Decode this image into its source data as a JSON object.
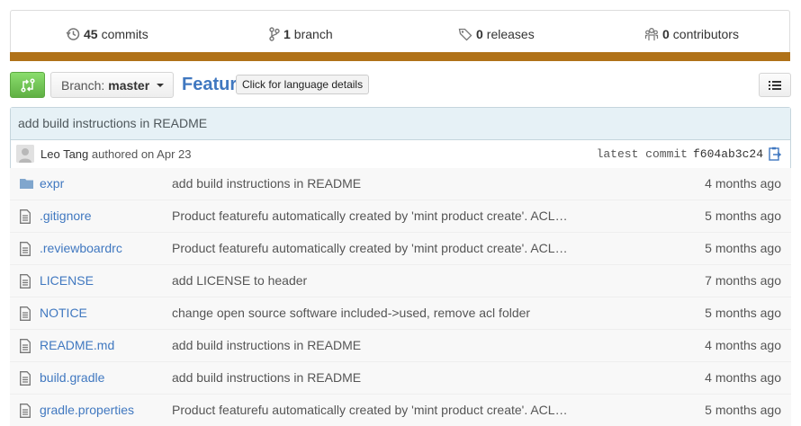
{
  "stats": {
    "commits": {
      "count": "45",
      "label": "commits"
    },
    "branches": {
      "count": "1",
      "label": "branch"
    },
    "releases": {
      "count": "0",
      "label": "releases"
    },
    "contributors": {
      "count": "0",
      "label": "contributors"
    },
    "language_color": "#b07219"
  },
  "toolbar": {
    "branch_prefix": "Branch:",
    "branch_name": "master",
    "repo_title": "Featur",
    "tooltip": "Click for language details"
  },
  "latest_commit": {
    "message": "add build instructions in README",
    "author": "Leo Tang",
    "authored_text": "authored on Apr 23",
    "label": "latest commit",
    "sha": "f604ab3c24"
  },
  "files": [
    {
      "icon": "folder-icon",
      "name": "expr",
      "message": "add build instructions in README",
      "age": "4 months ago"
    },
    {
      "icon": "file-icon",
      "name": ".gitignore",
      "message": "Product featurefu automatically created by 'mint product create'. ACL…",
      "age": "5 months ago"
    },
    {
      "icon": "file-icon",
      "name": ".reviewboardrc",
      "message": "Product featurefu automatically created by 'mint product create'. ACL…",
      "age": "5 months ago"
    },
    {
      "icon": "file-icon",
      "name": "LICENSE",
      "message": "add LICENSE to header",
      "age": "7 months ago"
    },
    {
      "icon": "file-icon",
      "name": "NOTICE",
      "message": "change open source software included->used, remove acl folder",
      "age": "5 months ago"
    },
    {
      "icon": "file-icon",
      "name": "README.md",
      "message": "add build instructions in README",
      "age": "4 months ago"
    },
    {
      "icon": "file-icon",
      "name": "build.gradle",
      "message": "add build instructions in README",
      "age": "4 months ago"
    },
    {
      "icon": "file-icon",
      "name": "gradle.properties",
      "message": "Product featurefu automatically created by 'mint product create'. ACL…",
      "age": "5 months ago"
    }
  ]
}
